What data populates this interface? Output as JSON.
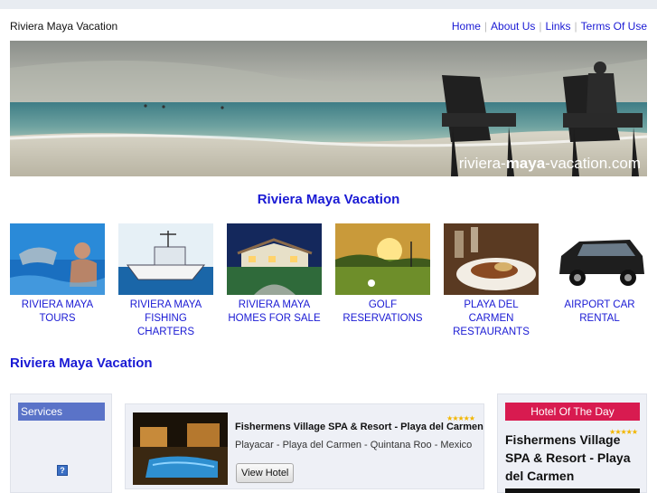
{
  "header": {
    "site_title": "Riviera Maya Vacation",
    "nav": [
      "Home",
      "About Us",
      "Links",
      "Terms Of Use"
    ]
  },
  "hero": {
    "watermark_prefix": "riviera-",
    "watermark_bold": "maya",
    "watermark_suffix": "-vacation.com"
  },
  "section_title": "Riviera Maya Vacation",
  "tiles": [
    {
      "line1": "RIVIERA MAYA",
      "line2": "TOURS"
    },
    {
      "line1": "RIVIERA MAYA",
      "line2": "FISHING CHARTERS"
    },
    {
      "line1": "RIVIERA MAYA",
      "line2": "HOMES FOR SALE"
    },
    {
      "line1": "GOLF",
      "line2": "RESERVATIONS"
    },
    {
      "line1": "PLAYA DEL CARMEN",
      "line2": "RESTAURANTS"
    },
    {
      "line1": "AIRPORT CAR",
      "line2": "RENTAL"
    }
  ],
  "content_heading": "Riviera Maya Vacation",
  "sidebar": {
    "header": "Services",
    "help_glyph": "?"
  },
  "hotel": {
    "name": "Fishermens Village SPA & Resort - Playa del Carmen",
    "location": "Playacar - Playa del Carmen - Quintana Roo - Mexico",
    "button": "View Hotel",
    "stars": "★★★★★",
    "rating": 5
  },
  "hotel_of_day": {
    "header": "Hotel Of The Day",
    "name": "Fishermens Village SPA & Resort - Playa del Carmen",
    "stars": "★★★★★",
    "rating": 5
  },
  "colors": {
    "link": "#1a1ad4",
    "sidebar_header": "#5a73c8",
    "hotel_of_day_header": "#d81b50",
    "stars": "#f2b600"
  }
}
